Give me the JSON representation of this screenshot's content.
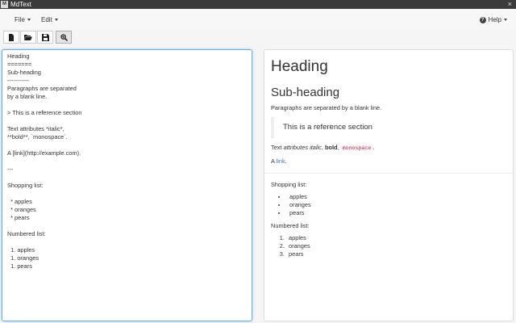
{
  "app": {
    "title": "MdText",
    "icon_text": "M"
  },
  "window": {
    "close_glyph": "×"
  },
  "menubar": {
    "file_label": "File",
    "edit_label": "Edit",
    "help_label": "Help",
    "help_glyph": "?"
  },
  "toolbar": {
    "icons": [
      "new-file-icon",
      "open-folder-icon",
      "save-icon",
      "zoom-icon"
    ]
  },
  "editor": {
    "text": "Heading\n=======\nSub-heading\n-----------\nParagraphs are separated\nby a blank line.\n\n> This is a reference section\n\nText attributes *italic*,\n**bold**, `monospace`.\n\nA [link](http://example.com).\n\n---\n\nShopping list:\n\n  * apples\n  * oranges\n  * pears\n\nNumbered list:\n\n  1. apples\n  1. oranges\n  1. pears"
  },
  "preview": {
    "heading": "Heading",
    "subheading": "Sub-heading",
    "paragraph": "Paragraphs are separated by a blank line.",
    "blockquote": "This is a reference section",
    "text_attr_prefix": "Text ",
    "italic": "attributes italic",
    "sep1": ", ",
    "bold": "bold",
    "sep2": ", ",
    "code": "monospace",
    "end_period": ".",
    "link_prefix": "A ",
    "link": "link",
    "link_suffix": ".",
    "shopping_label": "Shopping list:",
    "shopping": [
      "apples",
      "oranges",
      "pears"
    ],
    "numbered_label": "Numbered list:",
    "numbered": [
      "apples",
      "oranges",
      "pears"
    ]
  },
  "colors": {
    "accent": "#66afe9",
    "link": "#337ab7",
    "code": "#c7254e",
    "titlebar": "#3b3b3b"
  }
}
